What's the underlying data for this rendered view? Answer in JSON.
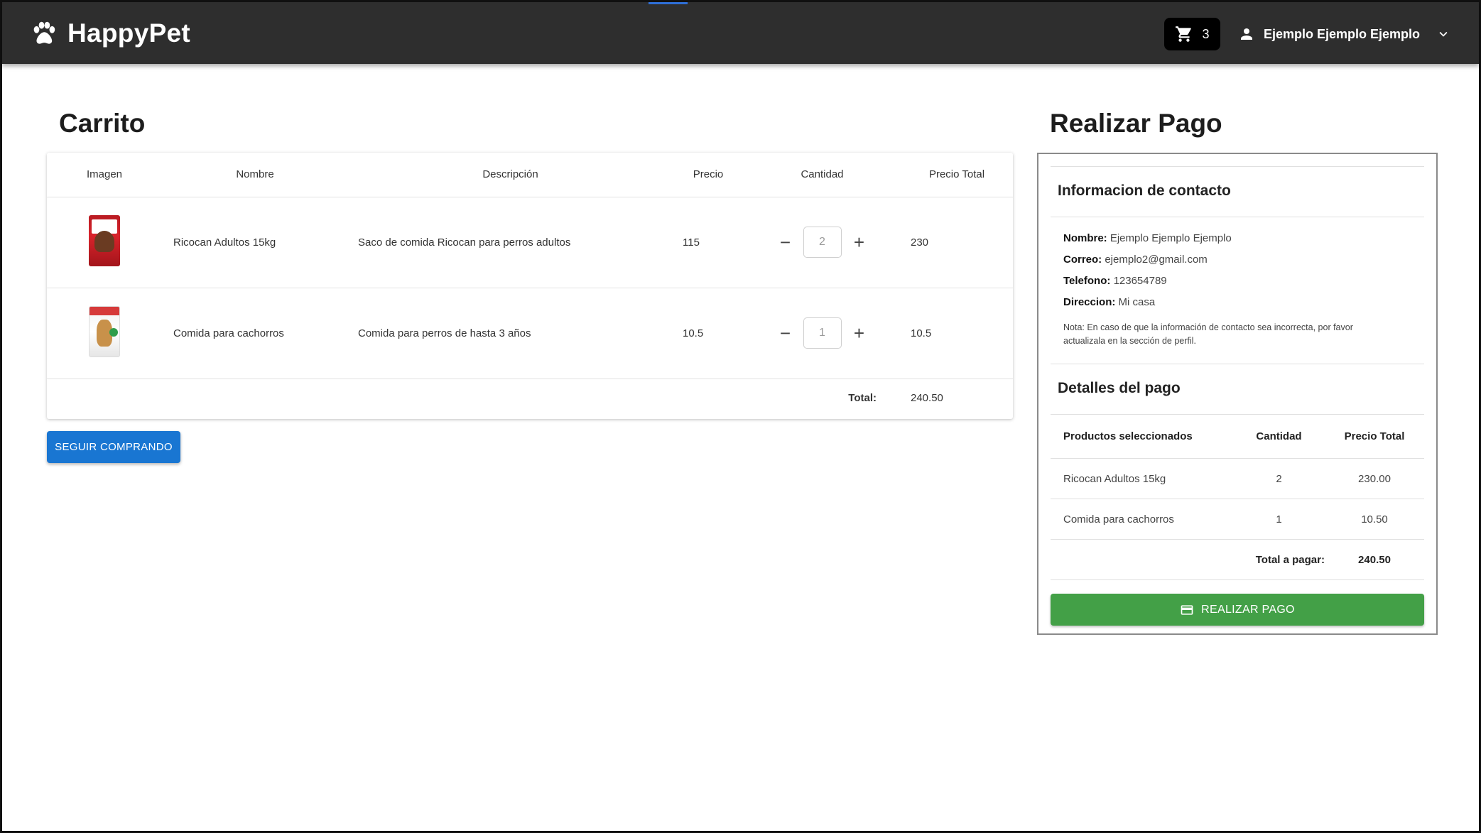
{
  "header": {
    "brand": "HappyPet",
    "cart_count": "3",
    "user_name": "Ejemplo Ejemplo Ejemplo"
  },
  "cart": {
    "title": "Carrito",
    "columns": [
      "Imagen",
      "Nombre",
      "Descripción",
      "Precio",
      "Cantidad",
      "Precio Total"
    ],
    "items": [
      {
        "name": "Ricocan Adultos 15kg",
        "description": "Saco de comida Ricocan para perros adultos",
        "price": "115",
        "quantity": "2",
        "total": "230",
        "image": "dog-food-bag-red"
      },
      {
        "name": "Comida para cachorros",
        "description": "Comida para perros de hasta 3 años",
        "price": "10.5",
        "quantity": "1",
        "total": "10.5",
        "image": "puppy-food-bag"
      }
    ],
    "total_label": "Total:",
    "total_value": "240.50",
    "continue_label": "SEGUIR COMPRANDO"
  },
  "payment": {
    "title": "Realizar Pago",
    "contact_title": "Informacion de contacto",
    "contact": {
      "name_label": "Nombre:",
      "name": "Ejemplo Ejemplo Ejemplo",
      "email_label": "Correo:",
      "email": "ejemplo2@gmail.com",
      "phone_label": "Telefono:",
      "phone": "123654789",
      "address_label": "Direccion:",
      "address": "Mi casa"
    },
    "note": "Nota: En caso de que la información de contacto sea incorrecta, por favor actualizala en la sección de perfil.",
    "details_title": "Detalles del pago",
    "columns": [
      "Productos seleccionados",
      "Cantidad",
      "Precio Total"
    ],
    "rows": [
      {
        "product": "Ricocan Adultos 15kg",
        "quantity": "2",
        "total": "230.00"
      },
      {
        "product": "Comida para cachorros",
        "quantity": "1",
        "total": "10.50"
      }
    ],
    "total_label": "Total a pagar:",
    "total_value": "240.50",
    "pay_label": "REALIZAR PAGO"
  },
  "colors": {
    "navbar": "#2e2e2e",
    "primary": "#1976d2",
    "success": "#43a047"
  }
}
